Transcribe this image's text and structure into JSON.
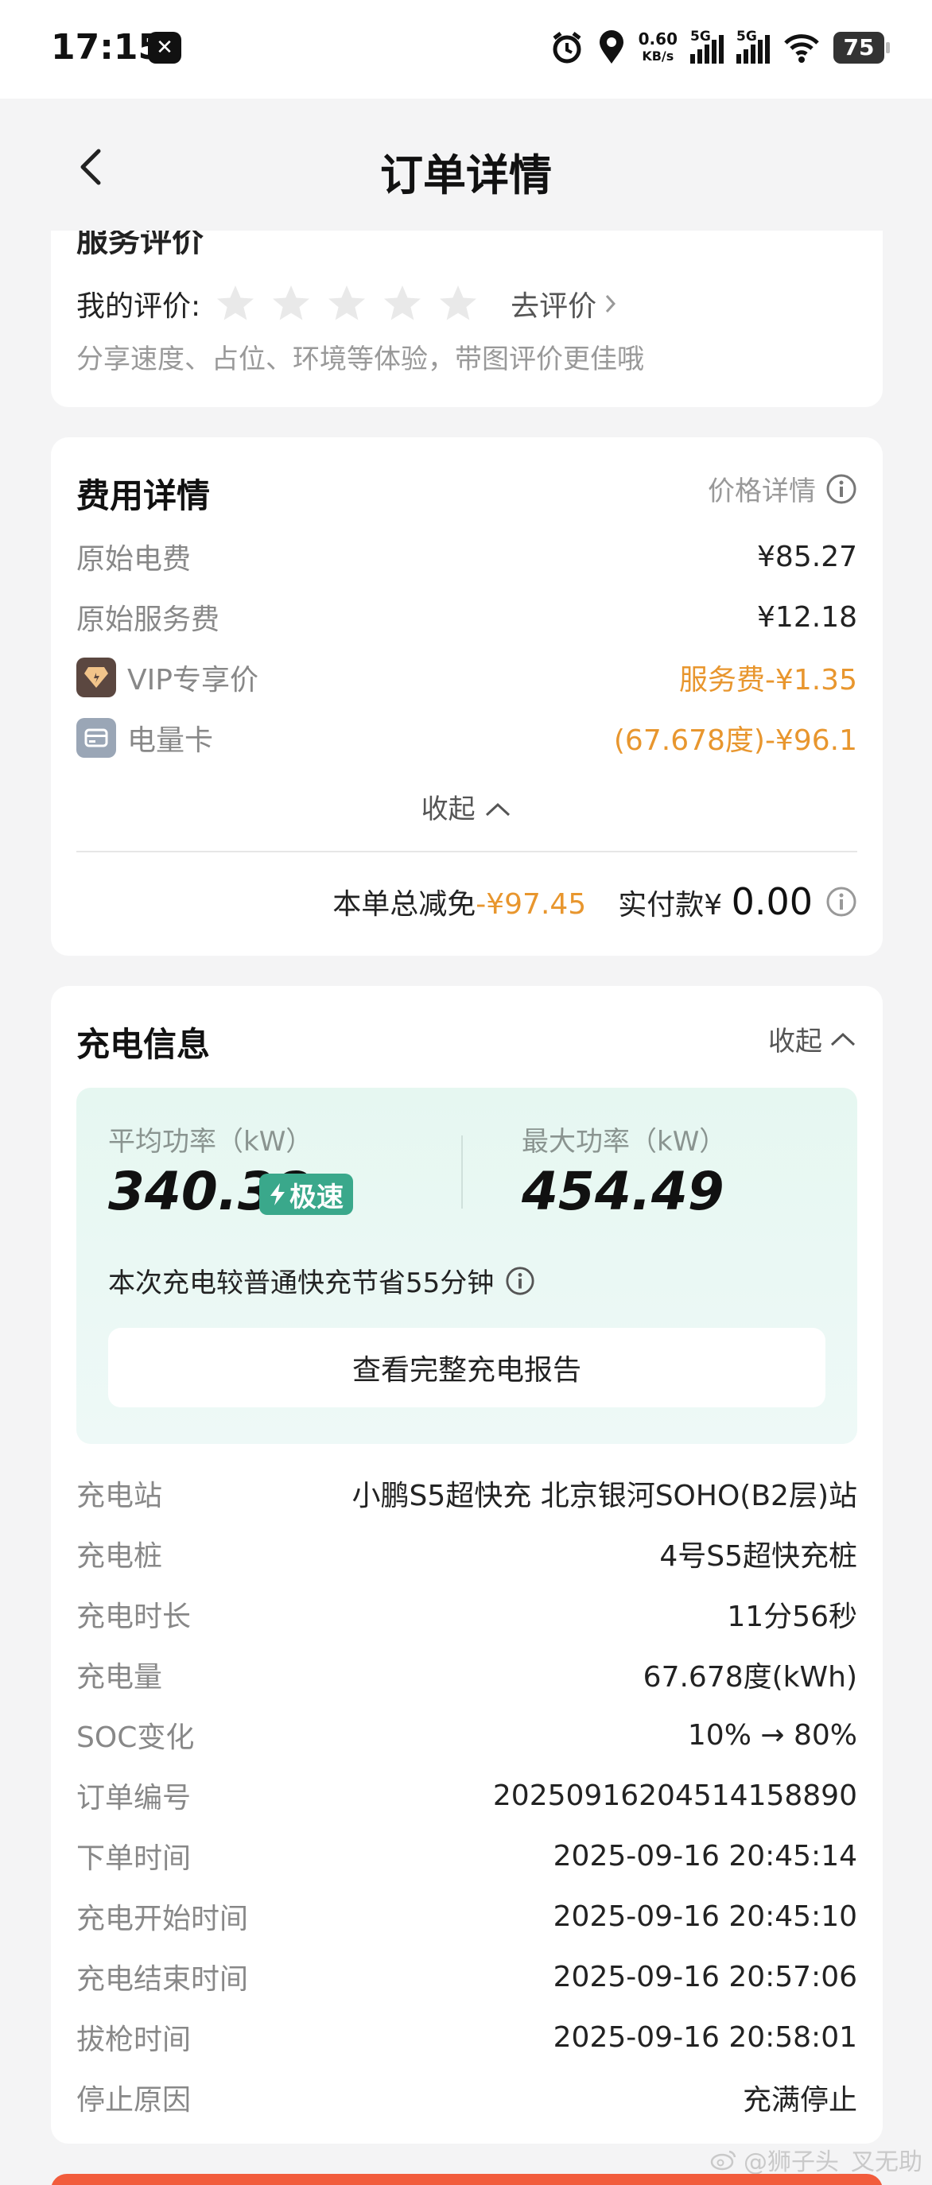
{
  "status_bar": {
    "time": "17:15",
    "net_speed_value": "0.60",
    "net_speed_unit": "KB/s",
    "signal1": "5G",
    "signal2": "5G",
    "battery": "75",
    "icons": [
      "app-x-icon",
      "alarm-icon",
      "location-icon",
      "signal-icon",
      "wifi-icon",
      "battery-icon"
    ]
  },
  "nav": {
    "title": "订单详情",
    "back_icon": "chevron-left-icon"
  },
  "service": {
    "title": "服务评价",
    "my_rating_label": "我的评价:",
    "rating": 0,
    "max_rating": 5,
    "go_rate": "去评价",
    "hint": "分享速度、占位、环境等体验，带图评价更佳哦"
  },
  "fee": {
    "title": "费用详情",
    "price_detail": "价格详情",
    "rows": [
      {
        "label": "原始电费",
        "value": "¥85.27"
      },
      {
        "label": "原始服务费",
        "value": "¥12.18"
      },
      {
        "label": "VIP专享价",
        "value": "服务费-¥1.35"
      },
      {
        "label": "电量卡",
        "value": "(67.678度)-¥96.1"
      }
    ],
    "collapse": "收起",
    "total_discount_label": "本单总减免",
    "total_discount_value": "-¥97.45",
    "pay_label": "实付款",
    "pay_currency": "¥",
    "pay_value": "0.00"
  },
  "charge": {
    "title": "充电信息",
    "collapse": "收起",
    "avg_power_label": "平均功率（kW）",
    "avg_power_value": "340.38",
    "fast_badge": "极速",
    "max_power_label": "最大功率（kW）",
    "max_power_value": "454.49",
    "saving_text": "本次充电较普通快充节省55分钟",
    "report_button": "查看完整充电报告",
    "rows": [
      {
        "label": "充电站",
        "value": "小鹏S5超快充 北京银河SOHO(B2层)站"
      },
      {
        "label": "充电桩",
        "value": "4号S5超快充桩"
      },
      {
        "label": "充电时长",
        "value": "11分56秒"
      },
      {
        "label": "充电量",
        "value": "67.678度(kWh)"
      },
      {
        "label": "SOC变化",
        "value": "10% → 80%"
      },
      {
        "label": "订单编号",
        "value": "20250916204514158890"
      },
      {
        "label": "下单时间",
        "value": "2025-09-16 20:45:14"
      },
      {
        "label": "充电开始时间",
        "value": "2025-09-16 20:45:10"
      },
      {
        "label": "充电结束时间",
        "value": "2025-09-16 20:57:06"
      },
      {
        "label": "拔枪时间",
        "value": "2025-09-16 20:58:01"
      },
      {
        "label": "停止原因",
        "value": "充满停止"
      }
    ]
  },
  "watermark": "@狮子头_叉无助",
  "colors": {
    "accent_orange": "#e8962e",
    "fast_green": "#3aa88b",
    "panel_mint": "#e6f7f1"
  }
}
